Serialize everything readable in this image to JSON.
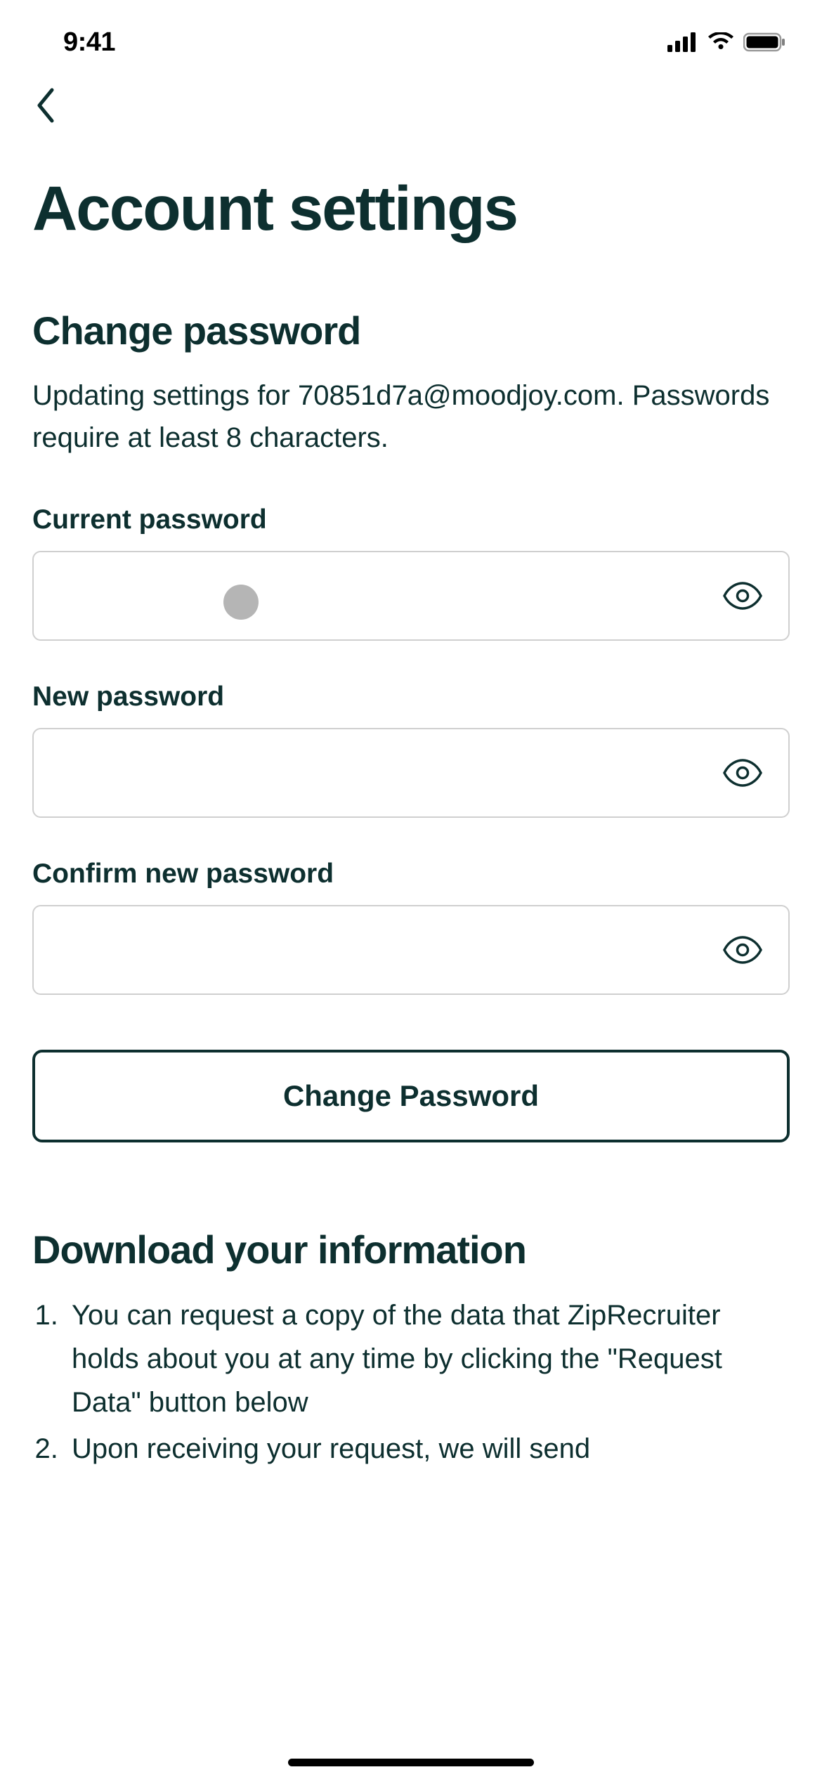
{
  "status_bar": {
    "time": "9:41"
  },
  "page": {
    "title": "Account settings"
  },
  "change_password": {
    "heading": "Change password",
    "description": "Updating settings for 70851d7a@moodjoy.com. Passwords require at least 8 characters.",
    "current_label": "Current password",
    "current_value": "",
    "new_label": "New password",
    "new_value": "",
    "confirm_label": "Confirm new password",
    "confirm_value": "",
    "submit_label": "Change Password"
  },
  "download_info": {
    "heading": "Download your information",
    "items": [
      "You can request a copy of the data that ZipRecruiter holds about you at any time by clicking the \"Request Data\" button below",
      "Upon receiving your request, we will send"
    ]
  }
}
